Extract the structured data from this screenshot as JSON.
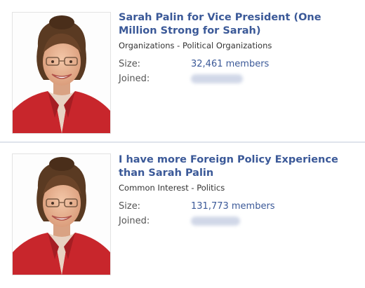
{
  "groups": [
    {
      "title": "Sarah Palin for Vice President (One Million Strong for Sarah)",
      "category": "Organizations - Political Organizations",
      "size_label": "Size:",
      "size_value": "32,461 members",
      "joined_label": "Joined:"
    },
    {
      "title": "I have more Foreign Policy Experience than Sarah Palin",
      "category": "Common Interest - Politics",
      "size_label": "Size:",
      "size_value": "131,773 members",
      "joined_label": "Joined:"
    }
  ],
  "colors": {
    "link": "#3b5998",
    "divider": "#d8dfea",
    "jacket": "#c8262c"
  }
}
